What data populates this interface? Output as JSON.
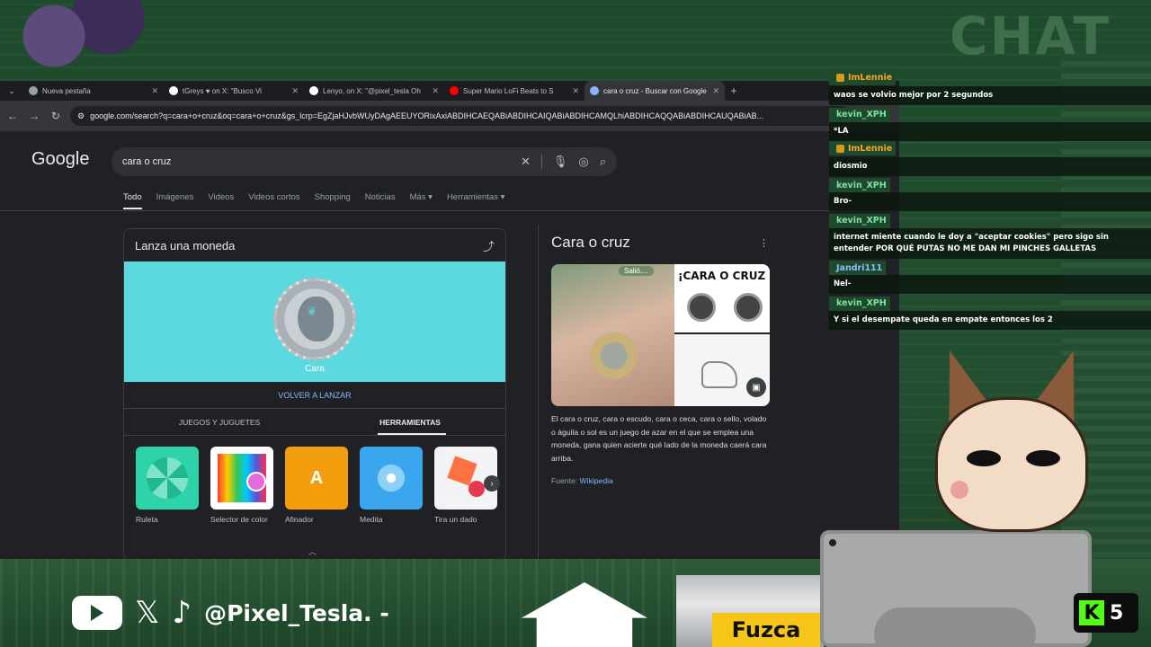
{
  "overlay": {
    "chat_heading": "CHAT",
    "handle": "@Pixel_Tesla. -",
    "bag_brand": "Fuzca",
    "kick_count": "5",
    "kick_letter": "K"
  },
  "browser": {
    "tabs": [
      {
        "label": "Nueva pestaña",
        "favicon_color": "#9aa0a6",
        "active": false
      },
      {
        "label": "tGreys ♥ on X: \"Busco Vi",
        "favicon_color": "#ffffff",
        "active": false
      },
      {
        "label": "Lenyo, on X: \"@pixel_tesla Oh",
        "favicon_color": "#ffffff",
        "active": false
      },
      {
        "label": "Super Mario LoFi Beats to S",
        "favicon_color": "#ff0000",
        "active": false
      },
      {
        "label": "cara o cruz - Buscar con Google",
        "favicon_color": "#8ab4f8",
        "active": true
      }
    ],
    "url": "google.com/search?q=cara+o+cruz&oq=cara+o+cruz&gs_lcrp=EgZjaHJvbWUyDAgAEEUYORixAxiABDIHCAEQABiABDIHCAIQABiABDIHCAMQLhiABDIHCAQQABiABDIHCAUQABiAB..."
  },
  "google": {
    "logo": "Google",
    "query": "cara o cruz",
    "nav": [
      "Todo",
      "Imágenes",
      "Videos",
      "Videos cortos",
      "Shopping",
      "Noticias",
      "Más ▾",
      "Herramientas ▾"
    ],
    "coin_card": {
      "title": "Lanza una moneda",
      "result": "Cara",
      "relaunch": "VOLVER A LANZAR",
      "tabs": [
        "JUEGOS Y JUGUETES",
        "HERRAMIENTAS"
      ],
      "active_tab": "HERRAMIENTAS",
      "tools": [
        {
          "label": "Ruleta",
          "icon": "wheel-icon"
        },
        {
          "label": "Selector de color",
          "icon": "color-picker-icon"
        },
        {
          "label": "Afinador",
          "icon": "tuner-icon"
        },
        {
          "label": "Medita",
          "icon": "meditate-icon"
        },
        {
          "label": "Tira un dado",
          "icon": "dice-icon"
        }
      ],
      "afinador_letter": "A"
    },
    "knowledge_panel": {
      "title": "Cara o cruz",
      "image_caption_bubble": "Salió....",
      "image_text": "¡CARA O CRUZ",
      "description": "El cara o cruz, cara o escudo, cara o ceca,  cara o sello, volado o águila o sol es un juego de azar en el que se emplea una moneda, gana quien acierte qué lado de la moneda caerá cara arriba.",
      "source_label": "Fuente:",
      "source_link": "Wikipedia"
    }
  },
  "chat": [
    {
      "user": "ImLennie",
      "user_color": "#f5a623",
      "badge": true,
      "text": "waos se volvio mejor por 2 segundos"
    },
    {
      "user": "kevin_XPH",
      "user_color": "#7fe0a8",
      "badge": false,
      "text": "*LA"
    },
    {
      "user": "ImLennie",
      "user_color": "#f5a623",
      "badge": true,
      "text": "diosmio"
    },
    {
      "user": "kevin_XPH",
      "user_color": "#7fe0a8",
      "badge": false,
      "text": "Bro-"
    },
    {
      "user": "kevin_XPH",
      "user_color": "#7fe0a8",
      "badge": false,
      "text": "internet miente cuando le doy a \"aceptar cookies\" pero sigo sin entender POR QUÉ PUTAS NO ME DAN MI PINCHES GALLETAS"
    },
    {
      "user": "Jandri111",
      "user_color": "#8fb8ff",
      "badge": false,
      "text": "Nel-"
    },
    {
      "user": "kevin_XPH",
      "user_color": "#7fe0a8",
      "badge": false,
      "text": "Y si el desempate queda en empate entonces los 2"
    }
  ]
}
